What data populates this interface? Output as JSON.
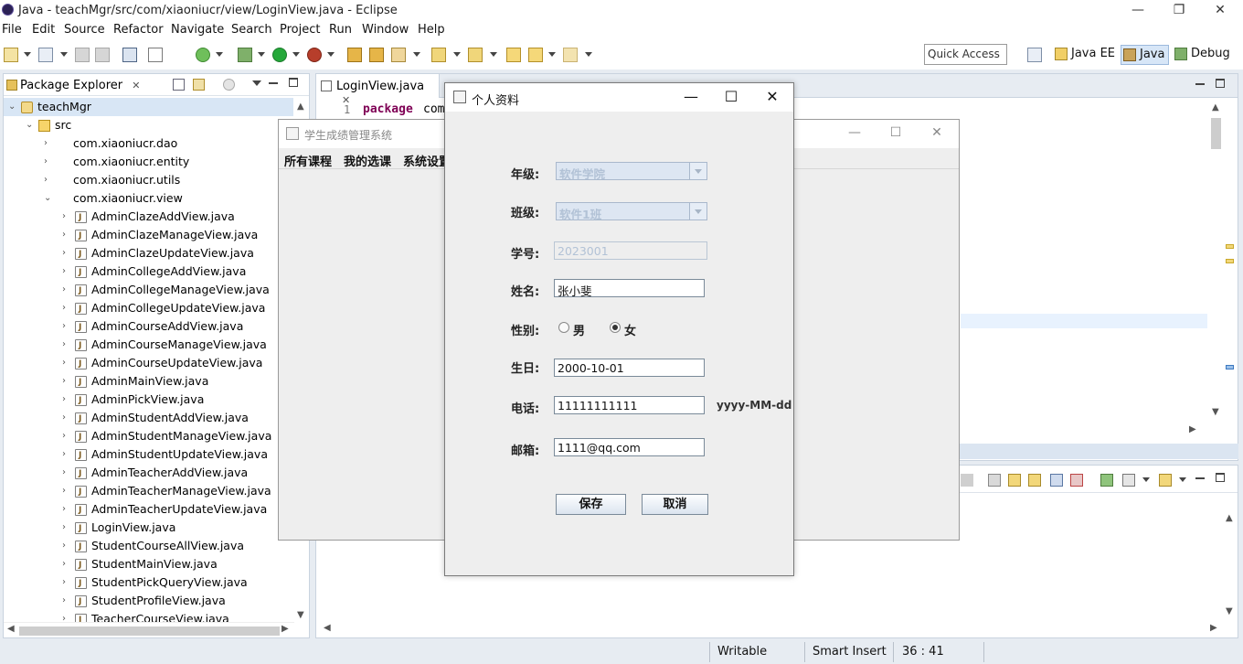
{
  "eclipse": {
    "title": "Java - teachMgr/src/com/xiaoniucr/view/LoginView.java - Eclipse",
    "menu": [
      "File",
      "Edit",
      "Source",
      "Refactor",
      "Navigate",
      "Search",
      "Project",
      "Run",
      "Window",
      "Help"
    ],
    "quick_access": "Quick Access",
    "perspectives": [
      "Java EE",
      "Java",
      "Debug"
    ],
    "active_perspective": "Java"
  },
  "package_explorer": {
    "tab_label": "Package Explorer",
    "tree": [
      {
        "label": "teachMgr",
        "kind": "project",
        "level": 0,
        "open": true,
        "selected": true
      },
      {
        "label": "src",
        "kind": "src",
        "level": 1,
        "open": true
      },
      {
        "label": "com.xiaoniucr.dao",
        "kind": "package",
        "level": 2,
        "open": false
      },
      {
        "label": "com.xiaoniucr.entity",
        "kind": "package",
        "level": 2,
        "open": false
      },
      {
        "label": "com.xiaoniucr.utils",
        "kind": "package",
        "level": 2,
        "open": false
      },
      {
        "label": "com.xiaoniucr.view",
        "kind": "package",
        "level": 2,
        "open": true
      },
      {
        "label": "AdminClazeAddView.java",
        "kind": "java",
        "level": 3
      },
      {
        "label": "AdminClazeManageView.java",
        "kind": "java",
        "level": 3
      },
      {
        "label": "AdminClazeUpdateView.java",
        "kind": "java",
        "level": 3
      },
      {
        "label": "AdminCollegeAddView.java",
        "kind": "java",
        "level": 3
      },
      {
        "label": "AdminCollegeManageView.java",
        "kind": "java",
        "level": 3
      },
      {
        "label": "AdminCollegeUpdateView.java",
        "kind": "java",
        "level": 3
      },
      {
        "label": "AdminCourseAddView.java",
        "kind": "java",
        "level": 3
      },
      {
        "label": "AdminCourseManageView.java",
        "kind": "java",
        "level": 3
      },
      {
        "label": "AdminCourseUpdateView.java",
        "kind": "java",
        "level": 3
      },
      {
        "label": "AdminMainView.java",
        "kind": "java",
        "level": 3
      },
      {
        "label": "AdminPickView.java",
        "kind": "java",
        "level": 3
      },
      {
        "label": "AdminStudentAddView.java",
        "kind": "java",
        "level": 3
      },
      {
        "label": "AdminStudentManageView.java",
        "kind": "java",
        "level": 3
      },
      {
        "label": "AdminStudentUpdateView.java",
        "kind": "java",
        "level": 3
      },
      {
        "label": "AdminTeacherAddView.java",
        "kind": "java",
        "level": 3
      },
      {
        "label": "AdminTeacherManageView.java",
        "kind": "java",
        "level": 3
      },
      {
        "label": "AdminTeacherUpdateView.java",
        "kind": "java",
        "level": 3
      },
      {
        "label": "LoginView.java",
        "kind": "java",
        "level": 3
      },
      {
        "label": "StudentCourseAllView.java",
        "kind": "java",
        "level": 3
      },
      {
        "label": "StudentMainView.java",
        "kind": "java",
        "level": 3
      },
      {
        "label": "StudentPickQueryView.java",
        "kind": "java",
        "level": 3
      },
      {
        "label": "StudentProfileView.java",
        "kind": "java",
        "level": 3
      },
      {
        "label": "TeacherCourseView.java",
        "kind": "java",
        "level": 3
      }
    ]
  },
  "editor": {
    "tab_label": "LoginView.java",
    "line_number": "1",
    "keyword": "package",
    "rest": "com"
  },
  "statusbar": {
    "writable": "Writable",
    "insert_mode": "Smart Insert",
    "position": "36 : 41"
  },
  "swing_main": {
    "title": "学生成绩管理系统",
    "menu": [
      "所有课程",
      "我的选课",
      "系统设置"
    ]
  },
  "dialog": {
    "title": "个人资料",
    "fields": {
      "grade_label": "年级:",
      "grade_value": "软件学院",
      "class_label": "班级:",
      "class_value": "软件1班",
      "student_no_label": "学号:",
      "student_no_value": "2023001",
      "name_label": "姓名:",
      "name_value": "张小斐",
      "gender_label": "性别:",
      "gender_male": "男",
      "gender_female": "女",
      "gender_selected": "女",
      "birthday_label": "生日:",
      "birthday_value": "2000-10-01",
      "phone_label": "电话:",
      "phone_value": "11111111111",
      "date_hint": "yyyy-MM-dd",
      "email_label": "邮箱:",
      "email_value": "1111@qq.com"
    },
    "save_label": "保存",
    "cancel_label": "取消"
  }
}
